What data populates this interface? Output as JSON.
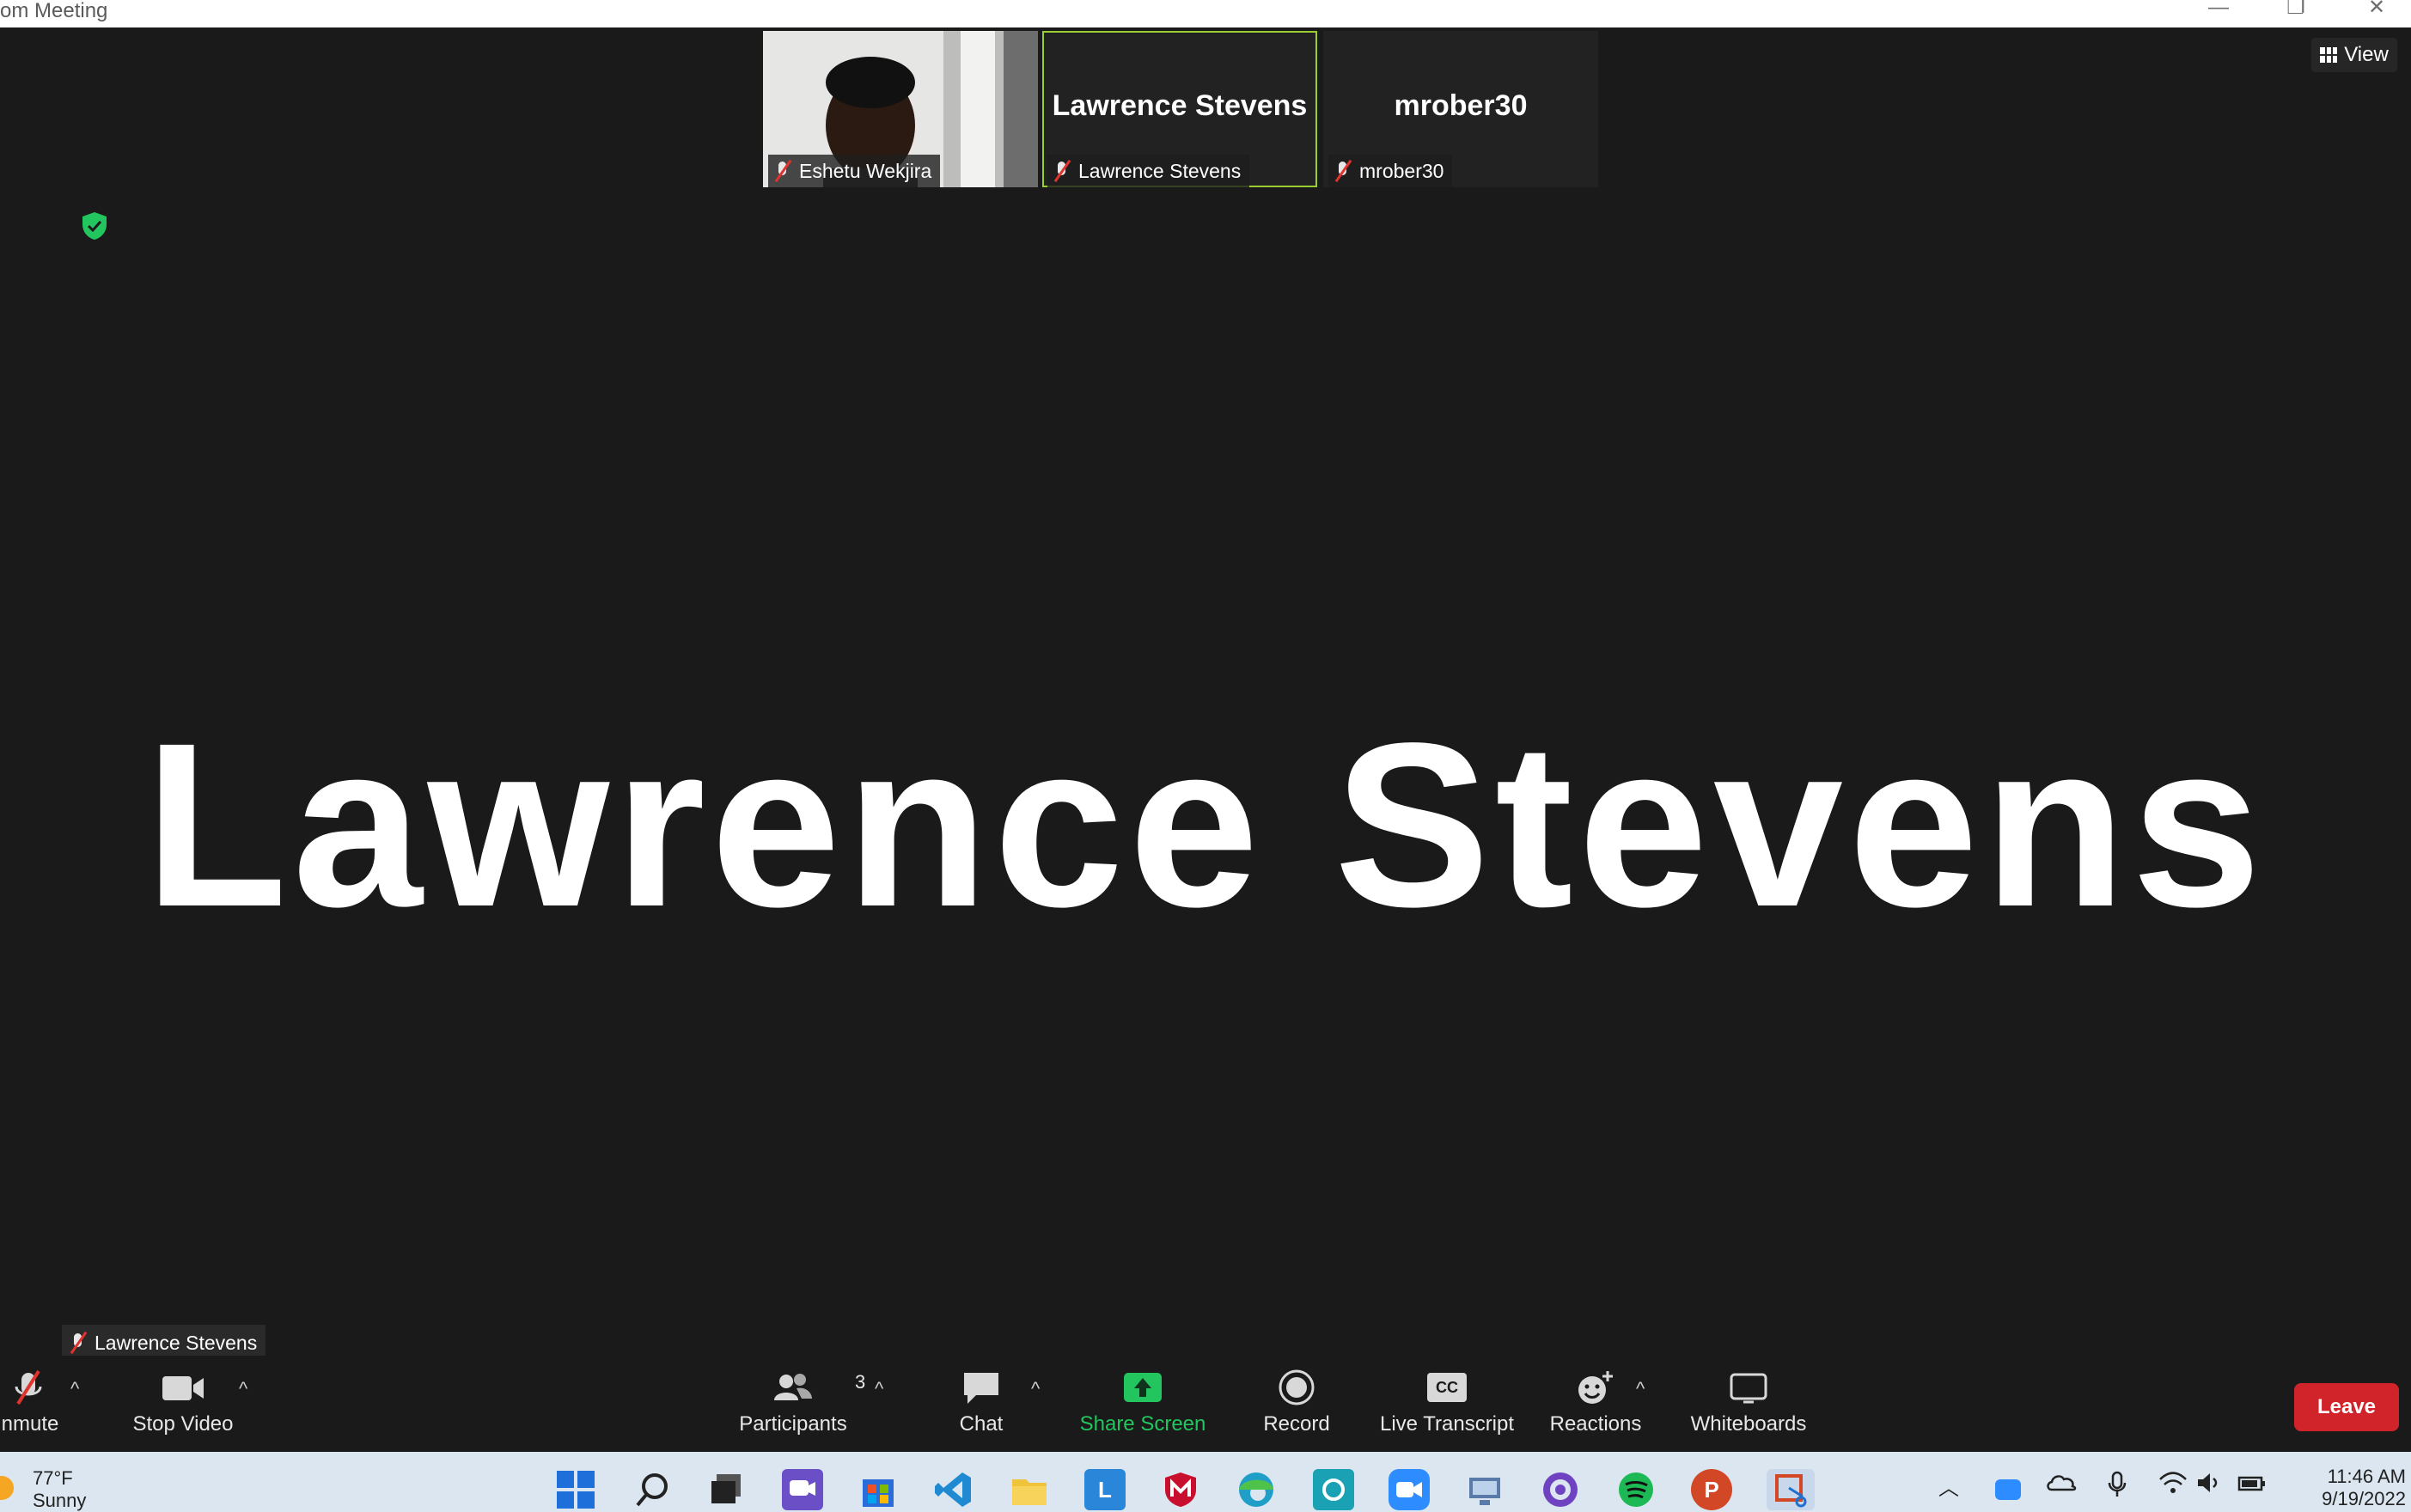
{
  "window": {
    "title": "om Meeting",
    "controls": [
      "minimize",
      "restore",
      "close"
    ]
  },
  "thumbnails": [
    {
      "name": "Eshetu Wekjira",
      "has_video": true
    },
    {
      "name": "Lawrence Stevens",
      "display": "Lawrence Stevens",
      "active": true
    },
    {
      "name": "mrober30",
      "display": "mrober30"
    }
  ],
  "view_button": {
    "label": "View"
  },
  "main": {
    "speaker_name": "Lawrence Stevens"
  },
  "self_label": {
    "name": "Lawrence Stevens"
  },
  "toolbar": {
    "unmute": "nmute",
    "stop_video": "Stop Video",
    "participants": "Participants",
    "participants_count": "3",
    "chat": "Chat",
    "share_screen": "Share Screen",
    "record": "Record",
    "live_transcript": "Live Transcript",
    "cc": "CC",
    "reactions": "Reactions",
    "whiteboards": "Whiteboards",
    "leave": "Leave"
  },
  "taskbar": {
    "weather_temp": "77°F",
    "weather_text": "Sunny",
    "time": "11:46 AM",
    "date": "9/19/2022",
    "letter_app": "L",
    "powerpoint_letter": "P"
  },
  "colors": {
    "accent_green": "#22c55e",
    "leave_red": "#d1232a",
    "active_border": "#9acd32"
  }
}
